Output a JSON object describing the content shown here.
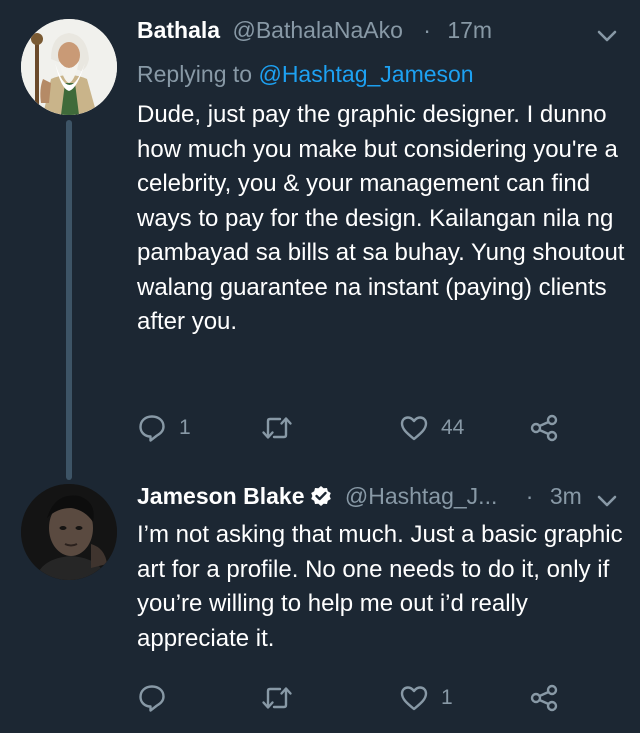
{
  "colors": {
    "background": "#1c2733",
    "text": "#ffffff",
    "secondary": "#8899a6",
    "link": "#1da1f2",
    "thread_line": "#3d5466"
  },
  "tweets": [
    {
      "display_name": "Bathala",
      "handle": "@BathalaNaAko",
      "separator": "·",
      "time": "17m",
      "replying_prefix": "Replying to",
      "replying_to": "@Hashtag_Jameson",
      "text": "Dude, just pay the graphic designer. I dunno how much you make but considering you're a celebrity, you & your management can find ways to pay for the design. Kailangan nila ng pambayad sa bills at sa buhay. Yung shoutout walang guarantee na instant (paying) clients after you.",
      "reply_count": "1",
      "retweet_count": "",
      "like_count": "44",
      "icons": [
        "caret-down-icon",
        "reply-icon",
        "retweet-icon",
        "like-icon",
        "share-icon"
      ]
    },
    {
      "display_name": "Jameson Blake",
      "verified": true,
      "handle": "@Hashtag_J...",
      "separator": "·",
      "time": "3m",
      "text": "I’m not asking that much. Just a basic graphic art for a profile. No one needs to do it, only if you’re willing to help me out i’d really appreciate it.",
      "reply_count": "",
      "retweet_count": "",
      "like_count": "1",
      "icons": [
        "caret-down-icon",
        "verified-badge-icon",
        "reply-icon",
        "retweet-icon",
        "like-icon",
        "share-icon"
      ]
    }
  ]
}
